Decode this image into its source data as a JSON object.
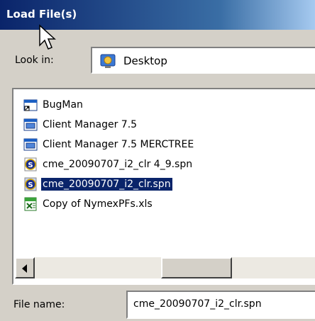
{
  "window": {
    "title": "Load File(s)"
  },
  "look_in": {
    "label": "Look in:",
    "value": "Desktop",
    "icon": "desktop-icon"
  },
  "files": [
    {
      "name": "BugMan",
      "icon": "shortcut-window-icon",
      "selected": false
    },
    {
      "name": "Client Manager 7.5",
      "icon": "application-icon",
      "selected": false
    },
    {
      "name": "Client Manager 7.5 MERCTREE",
      "icon": "application-icon",
      "selected": false
    },
    {
      "name": "cme_20090707_i2_clr 4_9.spn",
      "icon": "spn-file-icon",
      "selected": false
    },
    {
      "name": "cme_20090707_i2_clr.spn",
      "icon": "spn-file-icon",
      "selected": true
    },
    {
      "name": "Copy of NymexPFs.xls",
      "icon": "excel-file-icon",
      "selected": false
    }
  ],
  "file_name": {
    "label": "File name:",
    "value": "cme_20090707_i2_clr.spn"
  },
  "colors": {
    "title_start": "#0a246a",
    "title_end": "#a6caf0",
    "selection": "#0a246a",
    "face": "#d4d0c8"
  }
}
